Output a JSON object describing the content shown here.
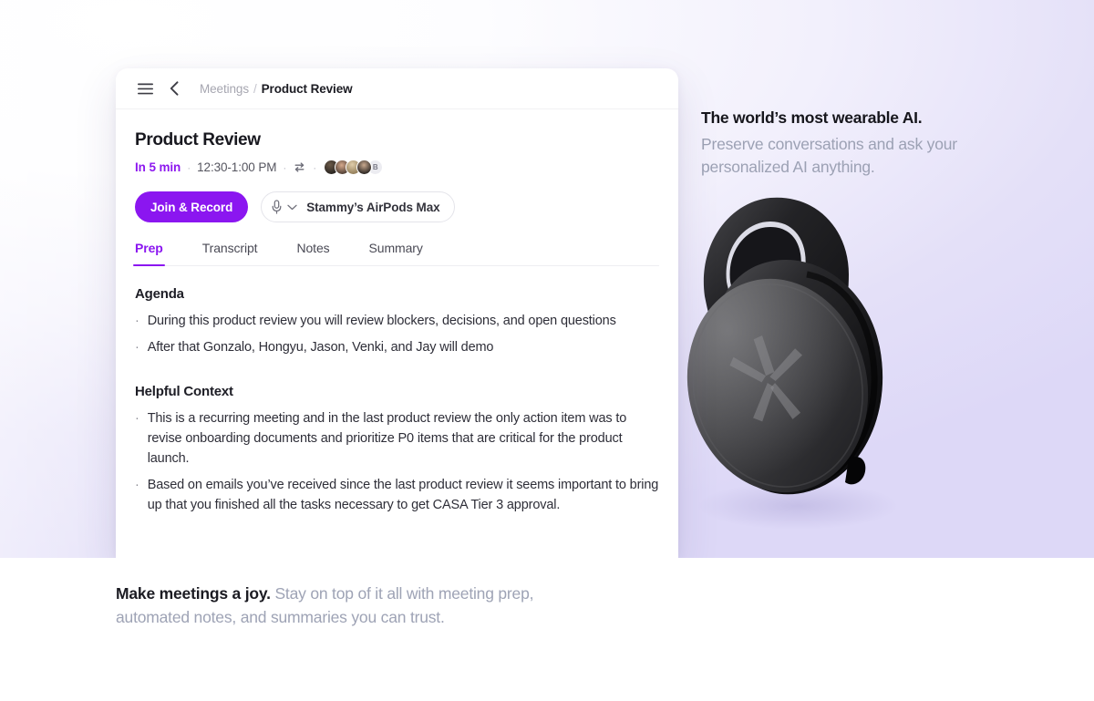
{
  "promo": {
    "headline": "The world’s most wearable AI.",
    "subline": "Preserve conversations and ask your personalized AI anything."
  },
  "caption": {
    "lead": "Make meetings a joy.",
    "rest": "Stay on top of it all with meeting prep, automated notes, and summaries you can trust."
  },
  "device": {
    "name": "wearable-ai-pendant",
    "body_color": "#1b1b1d",
    "face_color": "#3d3d40",
    "logo": "asterisk-star-logo"
  },
  "app": {
    "topbar": {
      "menu_icon": "hamburger-menu-icon",
      "back_icon": "chevron-left-icon",
      "breadcrumb_parent": "Meetings",
      "breadcrumb_separator": "/",
      "breadcrumb_current": "Product Review"
    },
    "meeting": {
      "title": "Product Review",
      "starts_in": "In 5 min",
      "time_range": "12:30-1:00 PM",
      "separator": "·",
      "recurring_icon": "repeat-icon",
      "attendees": [
        {
          "name": "attendee-1",
          "color_a": "#2b2622",
          "color_b": "#6b5a48"
        },
        {
          "name": "attendee-2",
          "color_a": "#d6a98c",
          "color_b": "#4a3b31"
        },
        {
          "name": "attendee-3",
          "color_a": "#e0cdab",
          "color_b": "#8f7a55"
        },
        {
          "name": "attendee-4",
          "color_a": "#c9a98e",
          "color_b": "#231f1d"
        }
      ],
      "overflow_initial": "B"
    },
    "actions": {
      "join_label": "Join & Record",
      "mic_icon": "microphone-icon",
      "chevron_icon": "chevron-down-icon",
      "device_label": "Stammy’s AirPods Max"
    },
    "tabs": [
      {
        "label": "Prep",
        "active": true
      },
      {
        "label": "Transcript",
        "active": false
      },
      {
        "label": "Notes",
        "active": false
      },
      {
        "label": "Summary",
        "active": false
      }
    ],
    "prep": {
      "agenda_title": "Agenda",
      "agenda_items": [
        "During this product review you will review blockers, decisions, and open questions",
        "After that Gonzalo, Hongyu, Jason, Venki, and Jay will demo"
      ],
      "context_title": "Helpful Context",
      "context_items": [
        "This is a recurring meeting and in the last product review the only action item was to revise onboarding documents and prioritize P0 items that are critical for the product launch.",
        "Based on emails you’ve received since the last product review it seems important to bring up that you finished all the tasks necessary to get CASA Tier 3 approval."
      ],
      "bullet_glyph": "·"
    }
  },
  "colors": {
    "accent": "#8b16f0",
    "hero_gradient_start": "#ffffff",
    "hero_gradient_end": "#ded9f7",
    "muted_text": "#9ca1b4"
  }
}
